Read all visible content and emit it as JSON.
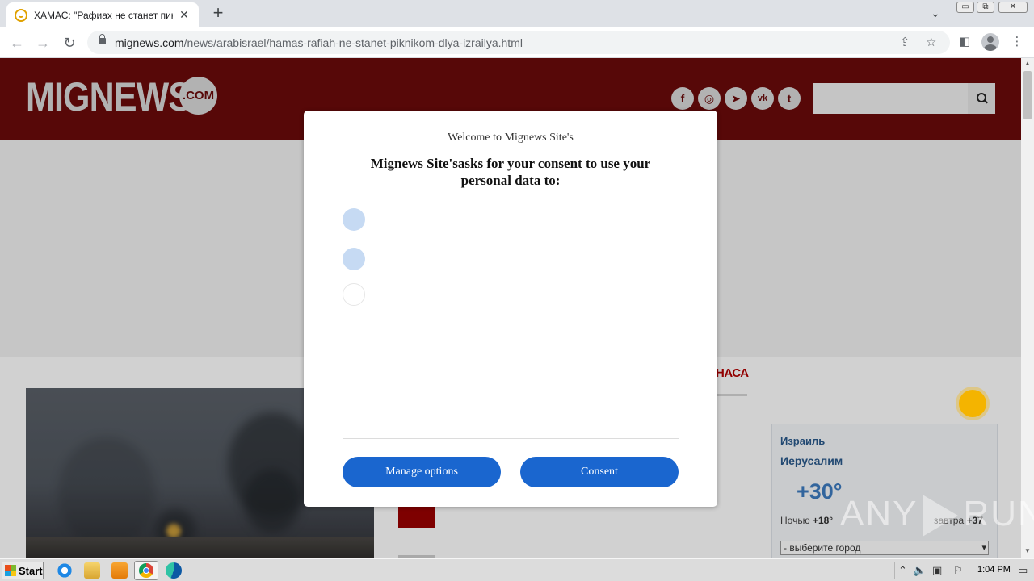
{
  "browser": {
    "tab_title": "ХАМАС: \"Рафиах не станет пикни",
    "tab_close": "✕",
    "new_tab": "+",
    "tab_menu": "⌄",
    "window_buttons": [
      "▭",
      "⧉",
      "✕"
    ],
    "url_domain": "mignews.com",
    "url_path": "/news/arabisrael/hamas-rafiah-ne-stanet-piknikom-dlya-izrailya.html",
    "icons": [
      "back-arrow-icon",
      "forward-arrow-icon",
      "reload-icon",
      "lock-icon",
      "share-icon",
      "star-icon",
      "side-panel-icon",
      "profile-icon",
      "kebab-menu-icon"
    ]
  },
  "site": {
    "logo_text": "MIGNEWS",
    "logo_badge": ".COM",
    "social": [
      "f",
      "◎",
      "➤",
      "vk",
      "t"
    ],
    "section_label": "НАСА",
    "weather": {
      "country": "Израиль",
      "city": "Иерусалим",
      "temp": "+30°",
      "night_label": "Ночью",
      "night_temp": "+18°",
      "day_label": "завтра",
      "day_temp": "+37",
      "city_select": "- выберите город"
    },
    "colors": {
      "header": "#6b0a0a",
      "accent_red": "#b30000",
      "weather_blue": "#2a5a8c"
    }
  },
  "dialog": {
    "welcome": "Welcome to Mignews Site's",
    "heading": "Mignews Site'sasks for your consent to use your personal data to:",
    "manage_label": "Manage options",
    "consent_label": "Consent",
    "button_color": "#1a66cf"
  },
  "watermark": {
    "left": "ANY",
    "right": "RUN"
  },
  "taskbar": {
    "start_label": "Start",
    "clock": "1:04 PM",
    "apps": [
      "ie-icon",
      "explorer-icon",
      "media-player-icon",
      "chrome-icon",
      "edge-icon"
    ]
  }
}
